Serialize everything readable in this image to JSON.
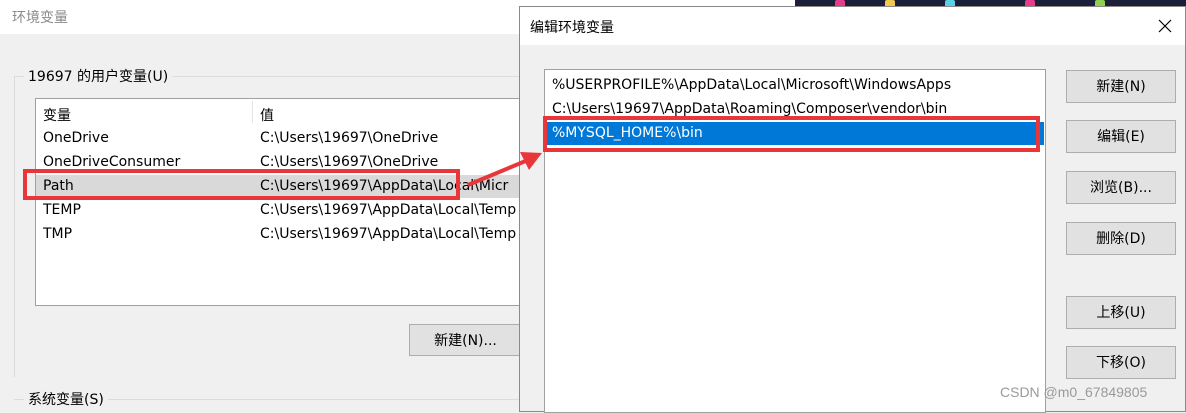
{
  "background_window": {
    "title": "环境变量",
    "user_vars_group": "19697 的用户变量(U)",
    "columns": {
      "variable": "变量",
      "value": "值"
    },
    "rows": [
      {
        "name": "OneDrive",
        "value": "C:\\Users\\19697\\OneDrive"
      },
      {
        "name": "OneDriveConsumer",
        "value": "C:\\Users\\19697\\OneDrive"
      },
      {
        "name": "Path",
        "value": "C:\\Users\\19697\\AppData\\Local\\Micr"
      },
      {
        "name": "TEMP",
        "value": "C:\\Users\\19697\\AppData\\Local\\Temp"
      },
      {
        "name": "TMP",
        "value": "C:\\Users\\19697\\AppData\\Local\\Temp"
      }
    ],
    "new_button": "新建(N)...",
    "system_vars_group": "系统变量(S)",
    "left_edge_fragment_a": "‹",
    "left_edge_fragment_b": "‹"
  },
  "dialog": {
    "title": "编辑环境变量",
    "paths": [
      "%USERPROFILE%\\AppData\\Local\\Microsoft\\WindowsApps",
      "C:\\Users\\19697\\AppData\\Roaming\\Composer\\vendor\\bin",
      "%MYSQL_HOME%\\bin"
    ],
    "selected_index": 2,
    "buttons": {
      "new": "新建(N)",
      "edit": "编辑(E)",
      "browse": "浏览(B)...",
      "delete": "删除(D)",
      "move_up": "上移(U)",
      "move_down": "下移(O)"
    }
  },
  "watermark": "CSDN @m0_67849805",
  "colors": {
    "selection": "#0078d7",
    "annotation_red": "#e8363a",
    "row_highlight": "#d9d9d9"
  },
  "icons": {
    "close": "close-icon"
  }
}
